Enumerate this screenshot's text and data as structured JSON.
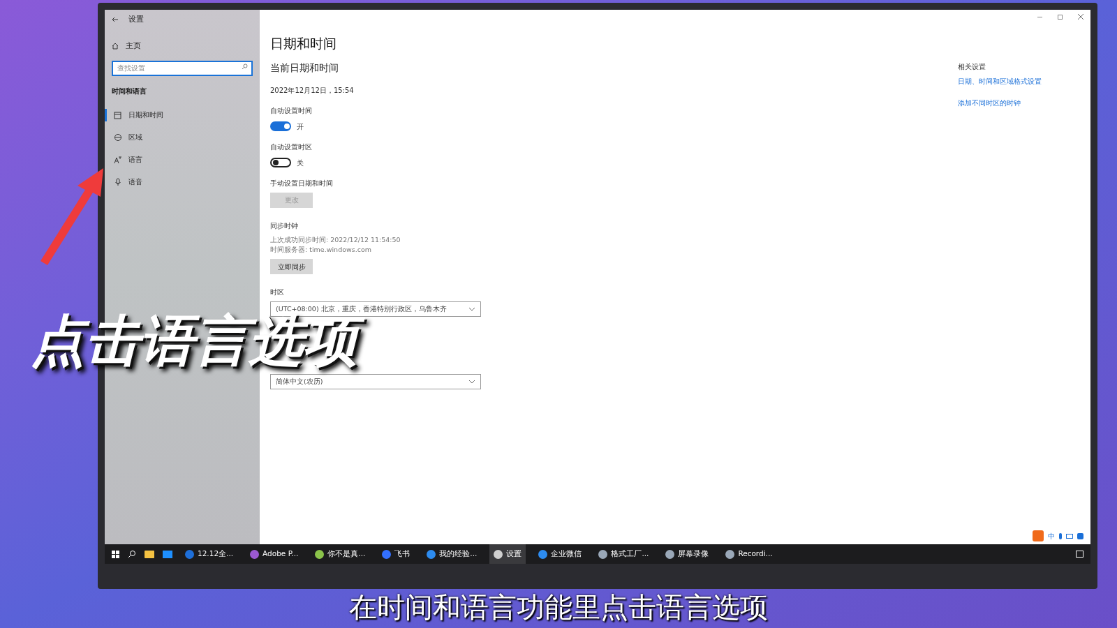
{
  "window": {
    "title": "设置"
  },
  "sidebar": {
    "home": "主页",
    "search": {
      "placeholder": "查找设置"
    },
    "section": "时间和语言",
    "items": [
      {
        "label": "日期和时间",
        "selected": true,
        "kind": "calendar"
      },
      {
        "label": "区域",
        "selected": false,
        "kind": "globe"
      },
      {
        "label": "语言",
        "selected": false,
        "kind": "language"
      },
      {
        "label": "语音",
        "selected": false,
        "kind": "mic"
      }
    ]
  },
  "main": {
    "title": "日期和时间",
    "subtitle": "当前日期和时间",
    "current": "2022年12月12日，15:54",
    "toggles": [
      {
        "label": "自动设置时间",
        "on": true,
        "state_text": "开"
      },
      {
        "label": "自动设置时区",
        "on": false,
        "state_text": "关"
      }
    ],
    "manual": {
      "label": "手动设置日期和时间",
      "button": "更改",
      "disabled": true
    },
    "sync": {
      "title": "同步时钟",
      "last": "上次成功同步时间: 2022/12/12 11:54:50",
      "server": "时间服务器: time.windows.com",
      "button": "立即同步"
    },
    "timezone": {
      "label": "时区",
      "value": "(UTC+08:00) 北京，重庆，香港特别行政区，乌鲁木齐"
    },
    "calendar": {
      "value": "简体中文(农历)"
    }
  },
  "related": {
    "title": "相关设置",
    "links": [
      "日期、时间和区域格式设置",
      "添加不同时区的时钟"
    ]
  },
  "taskbar": {
    "apps": [
      {
        "label": "12.12全...",
        "selected": false,
        "color": "#1e6fd9"
      },
      {
        "label": "Adobe P...",
        "selected": false,
        "color": "#9b59d0"
      },
      {
        "label": "你不是真...",
        "selected": false,
        "color": "#8bc34a"
      },
      {
        "label": "飞书",
        "selected": false,
        "color": "#3370ff"
      },
      {
        "label": "我的经验...",
        "selected": false,
        "color": "#2d8cf0"
      },
      {
        "label": "设置",
        "selected": true,
        "color": "#d0d0d0"
      },
      {
        "label": "企业微信",
        "selected": false,
        "color": "#2d8cf0"
      },
      {
        "label": "格式工厂...",
        "selected": false,
        "color": "#9aa8b8"
      },
      {
        "label": "屏幕录像",
        "selected": false,
        "color": "#9aa8b8"
      },
      {
        "label": "Recordi...",
        "selected": false,
        "color": "#9aa8b8"
      }
    ]
  },
  "ime": {
    "label": "中"
  },
  "caption": "点击语言选项",
  "subtitle": "在时间和语言功能里点击语言选项"
}
